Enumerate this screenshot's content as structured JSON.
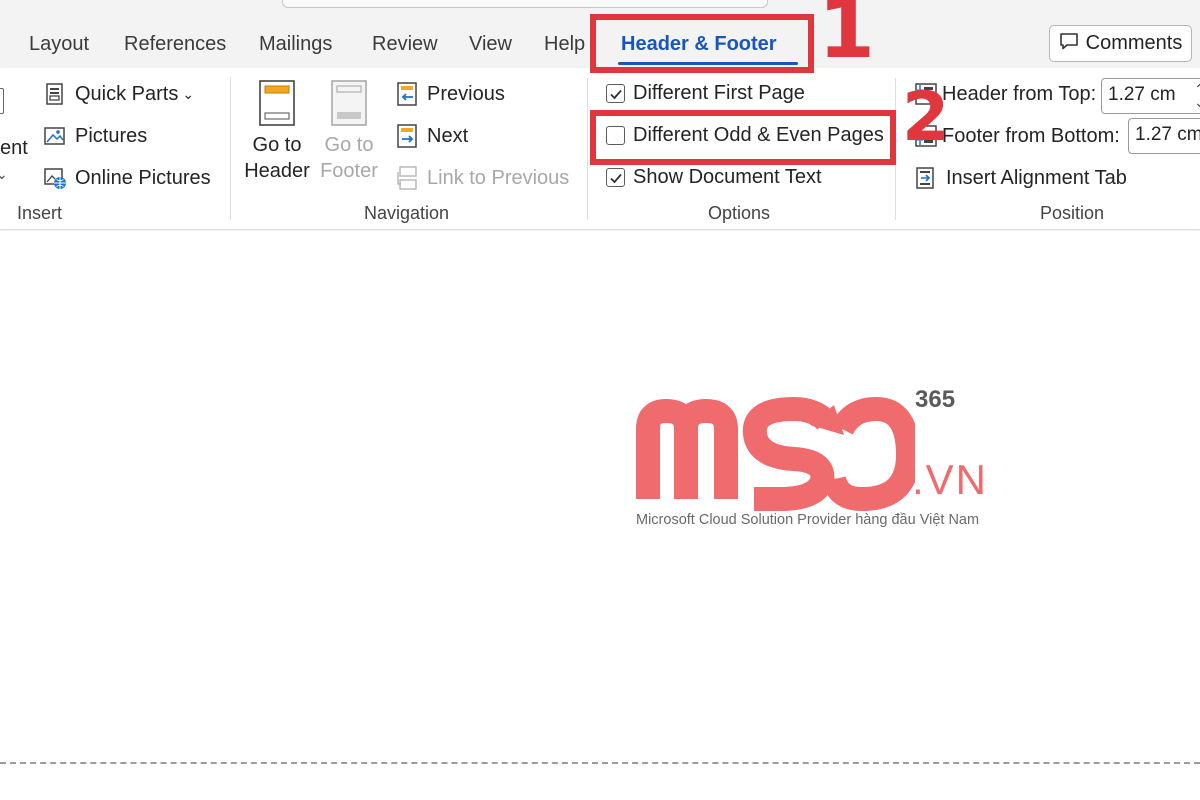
{
  "tabs": [
    {
      "label": "Layout"
    },
    {
      "label": "References"
    },
    {
      "label": "Mailings"
    },
    {
      "label": "Review"
    },
    {
      "label": "View"
    },
    {
      "label": "Help"
    },
    {
      "label": "Header & Footer",
      "active": true
    }
  ],
  "comments_label": "Comments",
  "groups": {
    "insert": {
      "label": "Insert",
      "partial_label": "ent",
      "items": [
        {
          "label": "Quick Parts",
          "icon": "quick-parts-icon"
        },
        {
          "label": "Pictures",
          "icon": "pictures-icon"
        },
        {
          "label": "Online Pictures",
          "icon": "online-pictures-icon"
        }
      ]
    },
    "navigation": {
      "label": "Navigation",
      "goto_header": {
        "line1": "Go to",
        "line2": "Header"
      },
      "goto_footer": {
        "line1": "Go to",
        "line2": "Footer",
        "enabled": false
      },
      "items": [
        {
          "label": "Previous",
          "enabled": true
        },
        {
          "label": "Next",
          "enabled": true
        },
        {
          "label": "Link to Previous",
          "enabled": false
        }
      ]
    },
    "options": {
      "label": "Options",
      "items": [
        {
          "label": "Different First Page",
          "checked": true
        },
        {
          "label": "Different Odd & Even Pages",
          "checked": false
        },
        {
          "label": "Show Document Text",
          "checked": true
        }
      ]
    },
    "position": {
      "label": "Position",
      "header_from_top": {
        "label": "Header from Top:",
        "value": "1.27 cm"
      },
      "footer_from_bottom": {
        "label": "Footer from Bottom:",
        "value": "1.27 cm"
      },
      "insert_alignment_tab": "Insert Alignment Tab"
    }
  },
  "annotations": {
    "step1": "1",
    "step2": "2"
  },
  "logo": {
    "superscript": "365",
    "domain": ".VN",
    "tagline": "Microsoft Cloud Solution Provider hàng đầu Việt Nam"
  },
  "colors": {
    "accent": "#1a56b9",
    "annotation": "#e0373f",
    "logo": "#ef6b6e"
  }
}
